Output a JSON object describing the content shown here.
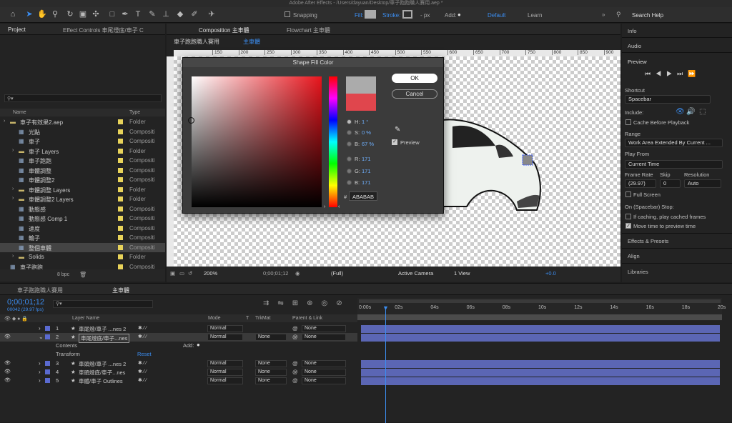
{
  "window": {
    "title": "Adobe After Effects - /Users/dayuan/Desktop/車子跑跑職人賽用.aep *"
  },
  "toolbar": {
    "snapping": "Snapping",
    "fill": "Fill:",
    "stroke": "Stroke:",
    "stroke_value": "- px",
    "add": "Add:",
    "workspace_default": "Default",
    "workspace_learn": "Learn",
    "search_help": "Search Help"
  },
  "project_panel": {
    "tab_project": "Project",
    "tab_effect_controls": "Effect Controls 車尾燈底/車子 C",
    "col_name": "Name",
    "col_type": "Type",
    "bpc": "8 bpc",
    "items": [
      {
        "name": "車子有效果2.aep",
        "type": "Folder",
        "color": "#e8d35a"
      },
      {
        "name": "光點",
        "type": "Compositi",
        "color": "#e8d35a"
      },
      {
        "name": "車子",
        "type": "Compositi",
        "color": "#e8d35a"
      },
      {
        "name": "車子 Layers",
        "type": "Folder",
        "color": "#e8d35a"
      },
      {
        "name": "車子跑跑",
        "type": "Compositi",
        "color": "#e8d35a"
      },
      {
        "name": "車體調整",
        "type": "Compositi",
        "color": "#e8d35a"
      },
      {
        "name": "車體調整2",
        "type": "Compositi",
        "color": "#e8d35a"
      },
      {
        "name": "車體調整 Layers",
        "type": "Folder",
        "color": "#e8d35a"
      },
      {
        "name": "車體調整2 Layers",
        "type": "Folder",
        "color": "#e8d35a"
      },
      {
        "name": "動態感",
        "type": "Compositi",
        "color": "#e8d35a"
      },
      {
        "name": "動態感 Comp 1",
        "type": "Compositi",
        "color": "#e8d35a"
      },
      {
        "name": "速度",
        "type": "Compositi",
        "color": "#e8d35a"
      },
      {
        "name": "輪子",
        "type": "Compositi",
        "color": "#e8d35a"
      },
      {
        "name": "整個車體",
        "type": "Compositi",
        "color": "#e8d35a"
      },
      {
        "name": "Solids",
        "type": "Folder",
        "color": "#e8d35a"
      },
      {
        "name": "車子跑跑",
        "type": "Compositi",
        "color": "#e8d35a"
      }
    ]
  },
  "composition_panel": {
    "tab_composition": "Composition 主車體",
    "tab_flowchart": "Flowchart 主車體",
    "breadcrumb_1": "車子跑跑職人賽用",
    "breadcrumb_2": "主車體",
    "ruler_labels": [
      "150",
      "200",
      "250",
      "300",
      "350",
      "400",
      "450",
      "500",
      "550",
      "600",
      "650",
      "700",
      "750",
      "800",
      "850",
      "900"
    ],
    "zoom": "200%",
    "timecode": "0;00;01;12",
    "resolution": "(Full)",
    "camera": "Active Camera",
    "view": "1 View",
    "exposure": "+0.0"
  },
  "dialog": {
    "title": "Shape Fill Color",
    "ok": "OK",
    "cancel": "Cancel",
    "preview": "Preview",
    "h_label": "H:",
    "h_value": "1 °",
    "s_label": "S:",
    "s_value": "0 %",
    "b_label": "B:",
    "b_value": "67 %",
    "r_label": "R:",
    "r_value": "171",
    "g_label": "G:",
    "g_value": "171",
    "b2_label": "B:",
    "b2_value": "171",
    "hex_label": "#",
    "hex_value": "ABABAB",
    "new_color": "#ababab",
    "current_color": "#e0464d",
    "hue_color": "#e8141c"
  },
  "right_panel": {
    "info": "Info",
    "audio": "Audio",
    "preview": "Preview",
    "shortcut": "Shortcut",
    "shortcut_value": "Spacebar",
    "include": "Include:",
    "cache_before": "Cache Before Playback",
    "range": "Range",
    "range_value": "Work Area Extended By Current ...",
    "play_from": "Play From",
    "play_from_value": "Current Time",
    "frame_rate": "Frame Rate",
    "skip": "Skip",
    "resolution": "Resolution",
    "frame_rate_value": "(29.97)",
    "skip_value": "0",
    "resolution_value": "Auto",
    "full_screen": "Full Screen",
    "on_stop": "On (Spacebar) Stop:",
    "if_caching": "If caching, play cached frames",
    "move_time": "Move time to preview time",
    "effects": "Effects & Presets",
    "align": "Align",
    "libraries": "Libraries"
  },
  "timeline": {
    "tab_1": "車子跑跑職人賽用",
    "tab_2": "主車體",
    "timecode": "0;00;01;12",
    "frame_info": "00042 (29.97 fps)",
    "col_layer_name": "Layer Name",
    "col_mode": "Mode",
    "col_t": "T",
    "col_trkmat": "TrkMat",
    "col_parent": "Parent & Link",
    "time_labels": [
      "0:00s",
      "02s",
      "04s",
      "06s",
      "08s",
      "10s",
      "12s",
      "14s",
      "16s",
      "18s",
      "20s"
    ],
    "layers": [
      {
        "num": "1",
        "name": "車尾燈/車子 ...nes 2",
        "mode": "Normal",
        "trkmat": "",
        "parent": "None"
      },
      {
        "num": "2",
        "name": "車尾燈底/車子...nes",
        "mode": "Normal",
        "trkmat": "None",
        "parent": "None"
      },
      {
        "num": "3",
        "name": "車頭燈/車子 ...nes 2",
        "mode": "Normal",
        "trkmat": "None",
        "parent": "None"
      },
      {
        "num": "4",
        "name": "車頭燈底/車子...nes",
        "mode": "Normal",
        "trkmat": "None",
        "parent": "None"
      },
      {
        "num": "5",
        "name": "車體/車子 Outlines",
        "mode": "Normal",
        "trkmat": "None",
        "parent": "None"
      }
    ],
    "contents": "Contents",
    "add": "Add:",
    "transform": "Transform",
    "reset": "Reset"
  }
}
